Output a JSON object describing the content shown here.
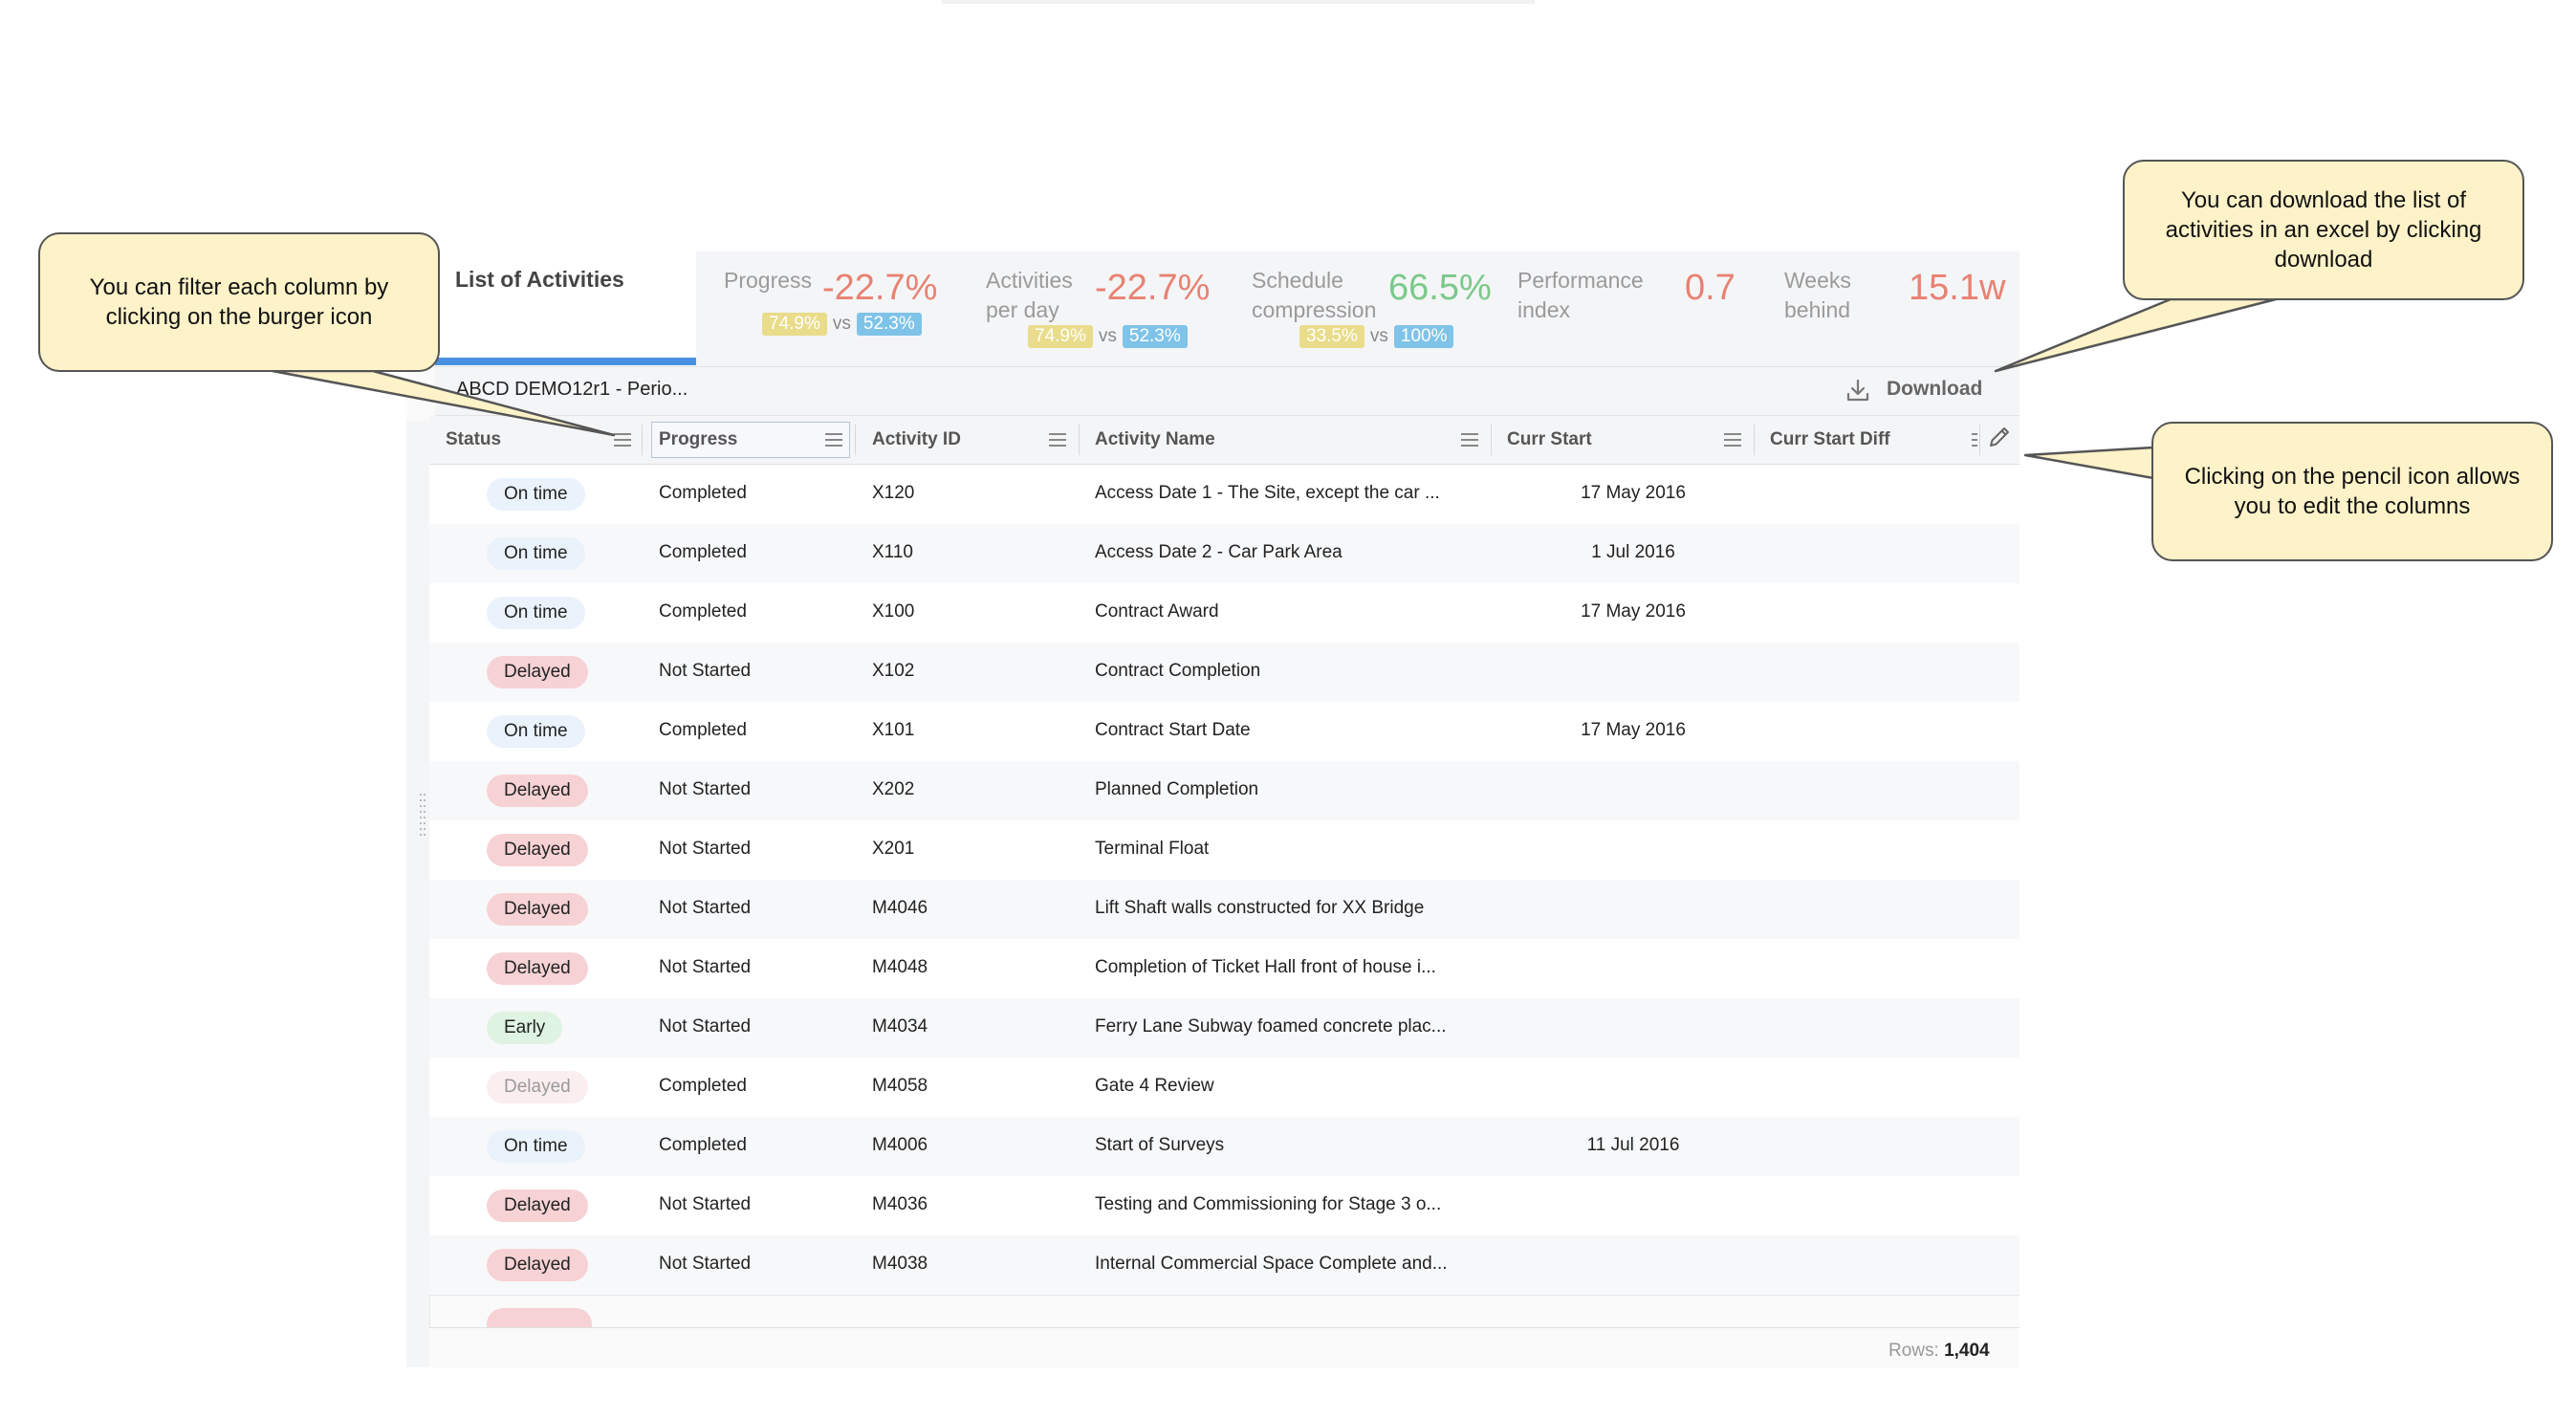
{
  "tab": {
    "title": "List of Activities"
  },
  "metrics": [
    {
      "label_line1": "Progress",
      "label_line2": "",
      "value": "-22.7%",
      "value_color": "#e88272",
      "pill_a": "74.9%",
      "vs": "vs",
      "pill_b": "52.3%"
    },
    {
      "label_line1": "Activities",
      "label_line2": "per day",
      "value": "-22.7%",
      "value_color": "#e88272",
      "pill_a": "74.9%",
      "vs": "vs",
      "pill_b": "52.3%"
    },
    {
      "label_line1": "Schedule",
      "label_line2": "compression",
      "value": "66.5%",
      "value_color": "#7bc98a",
      "pill_a": "33.5%",
      "vs": "vs",
      "pill_b": "100%"
    },
    {
      "label_line1": "Performance",
      "label_line2": "index",
      "value": "0.7",
      "value_color": "#e88272"
    },
    {
      "label_line1": "Weeks",
      "label_line2": "behind",
      "value": "15.1w",
      "value_color": "#e88272"
    }
  ],
  "project": {
    "name": "ABCD DEMO12r1 - Perio..."
  },
  "download": {
    "label": "Download",
    "icon": "download-icon"
  },
  "columns": [
    "Status",
    "Progress",
    "Activity ID",
    "Activity Name",
    "Curr Start",
    "Curr Start Diff"
  ],
  "rows": [
    {
      "status": "On time",
      "status_kind": "ontime",
      "progress": "Completed",
      "id": "X120",
      "name": "Access Date 1 - The Site, except the car ...",
      "curr_start": "17 May 2016"
    },
    {
      "status": "On time",
      "status_kind": "ontime",
      "progress": "Completed",
      "id": "X110",
      "name": "Access Date 2 - Car Park Area",
      "curr_start": "1 Jul 2016"
    },
    {
      "status": "On time",
      "status_kind": "ontime",
      "progress": "Completed",
      "id": "X100",
      "name": "Contract Award",
      "curr_start": "17 May 2016"
    },
    {
      "status": "Delayed",
      "status_kind": "delayed",
      "progress": "Not Started",
      "id": "X102",
      "name": "Contract Completion",
      "curr_start": ""
    },
    {
      "status": "On time",
      "status_kind": "ontime",
      "progress": "Completed",
      "id": "X101",
      "name": "Contract Start Date",
      "curr_start": "17 May 2016"
    },
    {
      "status": "Delayed",
      "status_kind": "delayed",
      "progress": "Not Started",
      "id": "X202",
      "name": "Planned Completion",
      "curr_start": ""
    },
    {
      "status": "Delayed",
      "status_kind": "delayed",
      "progress": "Not Started",
      "id": "X201",
      "name": "Terminal Float",
      "curr_start": ""
    },
    {
      "status": "Delayed",
      "status_kind": "delayed",
      "progress": "Not Started",
      "id": "M4046",
      "name": "Lift Shaft walls constructed for XX Bridge",
      "curr_start": ""
    },
    {
      "status": "Delayed",
      "status_kind": "delayed",
      "progress": "Not Started",
      "id": "M4048",
      "name": "Completion of Ticket Hall front of house i...",
      "curr_start": ""
    },
    {
      "status": "Early",
      "status_kind": "early",
      "progress": "Not Started",
      "id": "M4034",
      "name": "Ferry Lane Subway foamed concrete plac...",
      "curr_start": ""
    },
    {
      "status": "Delayed",
      "status_kind": "delayed-faint",
      "progress": "Completed",
      "id": "M4058",
      "name": "Gate 4 Review",
      "curr_start": ""
    },
    {
      "status": "On time",
      "status_kind": "ontime",
      "progress": "Completed",
      "id": "M4006",
      "name": "Start of Surveys",
      "curr_start": "11 Jul 2016"
    },
    {
      "status": "Delayed",
      "status_kind": "delayed",
      "progress": "Not Started",
      "id": "M4036",
      "name": "Testing and Commissioning for Stage 3 o...",
      "curr_start": ""
    },
    {
      "status": "Delayed",
      "status_kind": "delayed",
      "progress": "Not Started",
      "id": "M4038",
      "name": "Internal Commercial Space Complete and...",
      "curr_start": ""
    }
  ],
  "footer": {
    "rows_label": "Rows:",
    "rows_value": "1,404"
  },
  "callouts": {
    "filter": "You can filter each column by clicking on the burger icon",
    "download": "You can download the list of activities in an excel by clicking download",
    "pencil": "Clicking on the pencil icon allows you to edit the columns"
  },
  "colors": {
    "accent": "#4a90e2",
    "negative": "#e88272",
    "positive": "#7bc98a",
    "callout_bg": "#fdf2c8"
  }
}
